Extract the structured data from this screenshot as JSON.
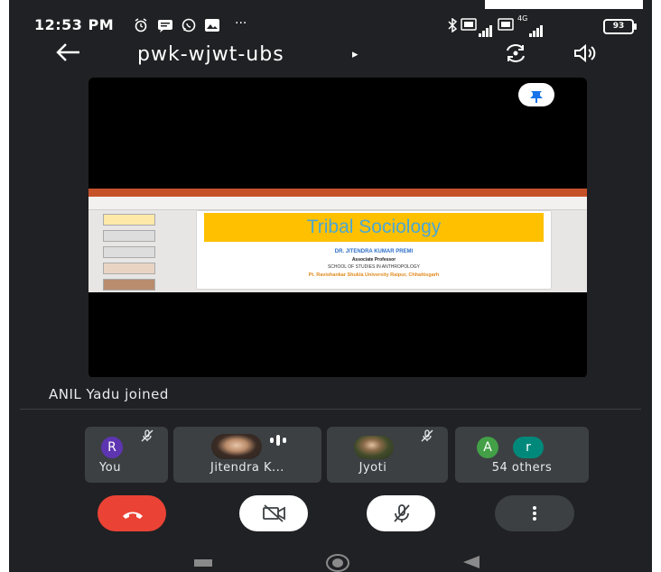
{
  "status_bar": {
    "time": "12:53 PM",
    "extra_icons": "···",
    "battery": "93"
  },
  "top_bar": {
    "meeting_code": "pwk-wjwt-ubs",
    "caret": "▸"
  },
  "presentation": {
    "title": "Tribal Sociology",
    "author": "DR. JITENDRA KUMAR PREMI",
    "role": "Associate Professor",
    "school": "SCHOOL OF STUDIES IN ANTHROPOLOGY",
    "university": "Pt. Ravishankar Shukla University Raipur, Chhattisgarh"
  },
  "notification": {
    "text": "ANIL Yadu joined"
  },
  "participants": [
    {
      "name": "You",
      "initial": "R",
      "avatar_color": "#5e35b1",
      "muted": true
    },
    {
      "name": "Jitendra K...",
      "speaking": true
    },
    {
      "name": "Jyoti",
      "muted": true
    },
    {
      "name": "54 others",
      "initials": [
        "A",
        "r"
      ],
      "avatar_colors": [
        "#43a047",
        "#00897b"
      ]
    }
  ],
  "colors": {
    "end_call": "#ea4335",
    "background": "#202124",
    "tile": "#3c4043"
  },
  "controls": [
    "end-call",
    "camera-off",
    "mic-off",
    "more-options"
  ]
}
